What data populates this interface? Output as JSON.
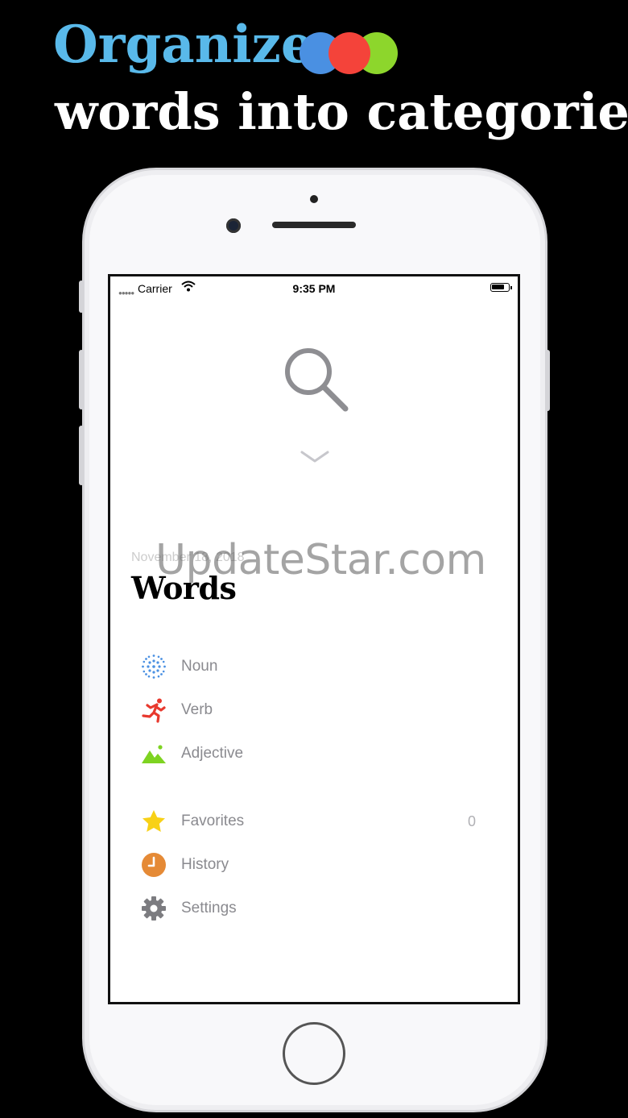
{
  "promo": {
    "title": "Organize",
    "subtitle": "words into categories",
    "dots": [
      {
        "color": "#4a90e2"
      },
      {
        "color": "#f4433a"
      },
      {
        "color": "#8dd62c"
      }
    ]
  },
  "status_bar": {
    "carrier": "Carrier",
    "time": "9:35 PM"
  },
  "header": {
    "date": "November 18, 2018",
    "watermark": "UpdateStar.com",
    "title": "Words"
  },
  "categories": [
    {
      "label": "Noun",
      "icon": "noun-dots-icon",
      "color": "#4a90e2"
    },
    {
      "label": "Verb",
      "icon": "running-person-icon",
      "color": "#e8392e"
    },
    {
      "label": "Adjective",
      "icon": "mountain-icon",
      "color": "#7ed321"
    }
  ],
  "menu": [
    {
      "label": "Favorites",
      "icon": "star-icon",
      "color": "#f8d117",
      "count": "0"
    },
    {
      "label": "History",
      "icon": "clock-icon",
      "color": "#e58a36"
    },
    {
      "label": "Settings",
      "icon": "gear-icon",
      "color": "#7c7c80"
    }
  ]
}
